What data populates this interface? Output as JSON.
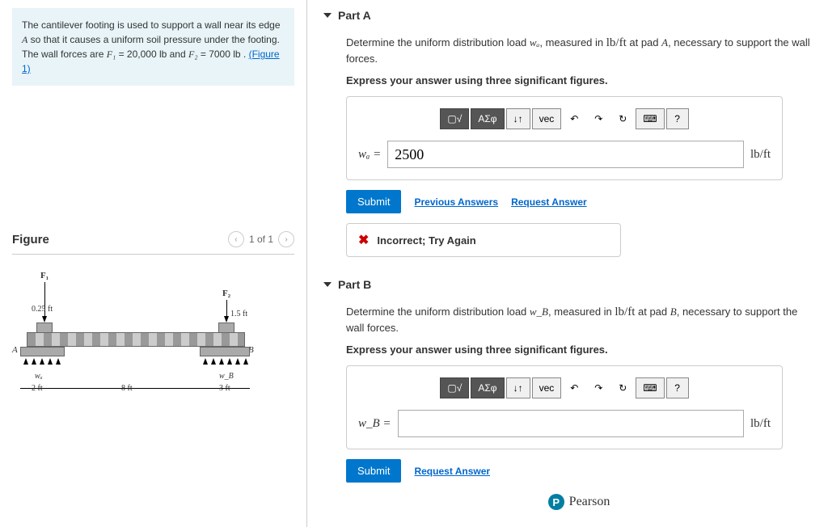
{
  "problem": {
    "text_pre": "The cantilever footing is used to support a wall near its edge ",
    "var_a": "A",
    "text_mid1": " so that it causes a uniform soil pressure under the footing. The wall forces are ",
    "f1_var": "F₁",
    "f1_val": " = 20,000 lb",
    "text_mid2": " and ",
    "f2_var": "F₂",
    "f2_val": " = 7000 lb",
    "text_post": " . ",
    "figure_link": "(Figure 1)"
  },
  "figure": {
    "title": "Figure",
    "nav_text": "1 of 1",
    "labels": {
      "F1": "F₁",
      "F2": "F₂",
      "A": "A",
      "B": "B",
      "wA": "wₐ",
      "wB": "w_B",
      "d025": "0.25 ft",
      "d15": "1.5 ft",
      "d2": "2 ft",
      "d8": "8 ft",
      "d3": "3 ft"
    }
  },
  "partA": {
    "title": "Part A",
    "prompt_pre": "Determine the uniform distribution load ",
    "prompt_var": "wₐ",
    "prompt_mid": ", measured in ",
    "prompt_unit": "lb/ft",
    "prompt_mid2": " at pad ",
    "prompt_pad": "A",
    "prompt_post": ", necessary to support the wall forces.",
    "hint": "Express your answer using three significant figures.",
    "var_label": "wₐ = ",
    "value": "2500",
    "unit": "lb/ft",
    "submit": "Submit",
    "prev_answers": "Previous Answers",
    "request": "Request Answer",
    "feedback": "Incorrect; Try Again"
  },
  "partB": {
    "title": "Part B",
    "prompt_pre": "Determine the uniform distribution load ",
    "prompt_var": "w_B",
    "prompt_mid": ", measured in ",
    "prompt_unit": "lb/ft",
    "prompt_mid2": " at pad ",
    "prompt_pad": "B",
    "prompt_post": ", necessary to support the wall forces.",
    "hint": "Express your answer using three significant figures.",
    "var_label": "w_B = ",
    "value": "",
    "unit": "lb/ft",
    "submit": "Submit",
    "request": "Request Answer"
  },
  "toolbar": {
    "templates": "▢√",
    "greek": "ΑΣφ",
    "updown": "↓↑",
    "vec": "vec",
    "undo": "↶",
    "redo": "↷",
    "reset": "↻",
    "keyboard": "⌨",
    "help": "?"
  },
  "pearson": {
    "logo": "P",
    "text": "Pearson"
  }
}
